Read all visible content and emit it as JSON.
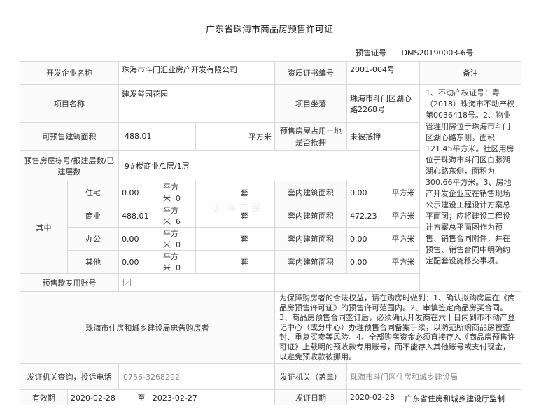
{
  "title": "广东省珠海市商品房预售许可证",
  "cert": {
    "label": "预售证号",
    "value": "DMS20190003-6号"
  },
  "developer": {
    "label": "开发企业名称",
    "value": "珠海市斗门汇业房产开发有限公司"
  },
  "qual": {
    "label": "资质证书编号",
    "value": "2001-004号"
  },
  "notes": {
    "label": "备注",
    "text": "1、不动产权证号：粤（2018）珠海市不动产权第0036418号。2、物业管理用房位于珠海市斗门区湖心路东侧，面积121.45平方米。社区用房位于珠海市斗门区白藤湖湖心路东侧，面积为300.66平方米。3、房地产开发企业应在销售现场公示建设工程设计方案总平面图；应将建设工程设计方案总平面图作为预售、销售合同附件，并在预售、销售合同中明确约定配套设施移交事项。"
  },
  "project": {
    "label": "项目名称",
    "value": "建发玺园花园"
  },
  "location": {
    "label": "项目坐落",
    "value": "珠海市斗门区湖心路2268号"
  },
  "area": {
    "label": "可预售建筑面积",
    "value": "488.01",
    "unit": "平方米"
  },
  "mortgage": {
    "label": "预售房屋占用土地是否抵押",
    "value": "未被抵押"
  },
  "building": {
    "label": "预售房屋栋号/报建层数/已建层数",
    "value": "9#楼商业/1层/1层"
  },
  "breakdown": {
    "label": "其中",
    "rows": [
      {
        "type": "住宅",
        "area": "0.00",
        "unit": "平方米",
        "count": "0",
        "cunit": "套",
        "inlabel": "套内建筑面积",
        "inarea": "0.00",
        "inunit": "平方米"
      },
      {
        "type": "商业",
        "area": "488.01",
        "unit": "平方米",
        "count": "6",
        "cunit": "套",
        "inlabel": "套内建筑面积",
        "inarea": "472.23",
        "inunit": "平方米"
      },
      {
        "type": "办公",
        "area": "0.00",
        "unit": "平方米",
        "count": "0",
        "cunit": "套",
        "inlabel": "套内建筑面积",
        "inarea": "0.00",
        "inunit": "平方米"
      },
      {
        "type": "其他",
        "area": "0.00",
        "unit": "平方米",
        "count": "0",
        "cunit": "套",
        "inlabel": "套内建筑面积",
        "inarea": "0.00",
        "inunit": "平方米"
      }
    ]
  },
  "account": {
    "label": "预售款专用账号"
  },
  "warning": {
    "label": "珠海市住房和城乡建设局忠告购房者",
    "text": "为保障购房者的合法权益，请在购房时做到：1、确认拟购房屋在《商品房预售许可证》的预售许可范围内。2、审慎签定商品房买合同。3、商品房预售合同签订后，必须确认开发商在六十日内到市不动产登记中心（或分中心）办理预售合同备案手续，以防范所购商品房被查封、重复买卖等风险。4、全部购房资金必须直接存入《商品房预售许可证》上载明的预收款专用账号，而不能存入其他账号或支付现金，以避免预收款被挪用。"
  },
  "phone": {
    "label": "发证机关查询，投诉电话",
    "value": "0756-3268292"
  },
  "issuer": {
    "label": "发证机关（盖章）",
    "value": "珠海市斗门区住房和城乡建设局"
  },
  "validity": {
    "label": "有效期",
    "from": "2020-02-28",
    "to_label": "至",
    "to": "2023-02-27"
  },
  "issue_date": {
    "label": "发证日期",
    "value": "2020-02-28"
  },
  "footer": "广东省住房和城乡建设厅监制",
  "watermark": "汇海市民"
}
